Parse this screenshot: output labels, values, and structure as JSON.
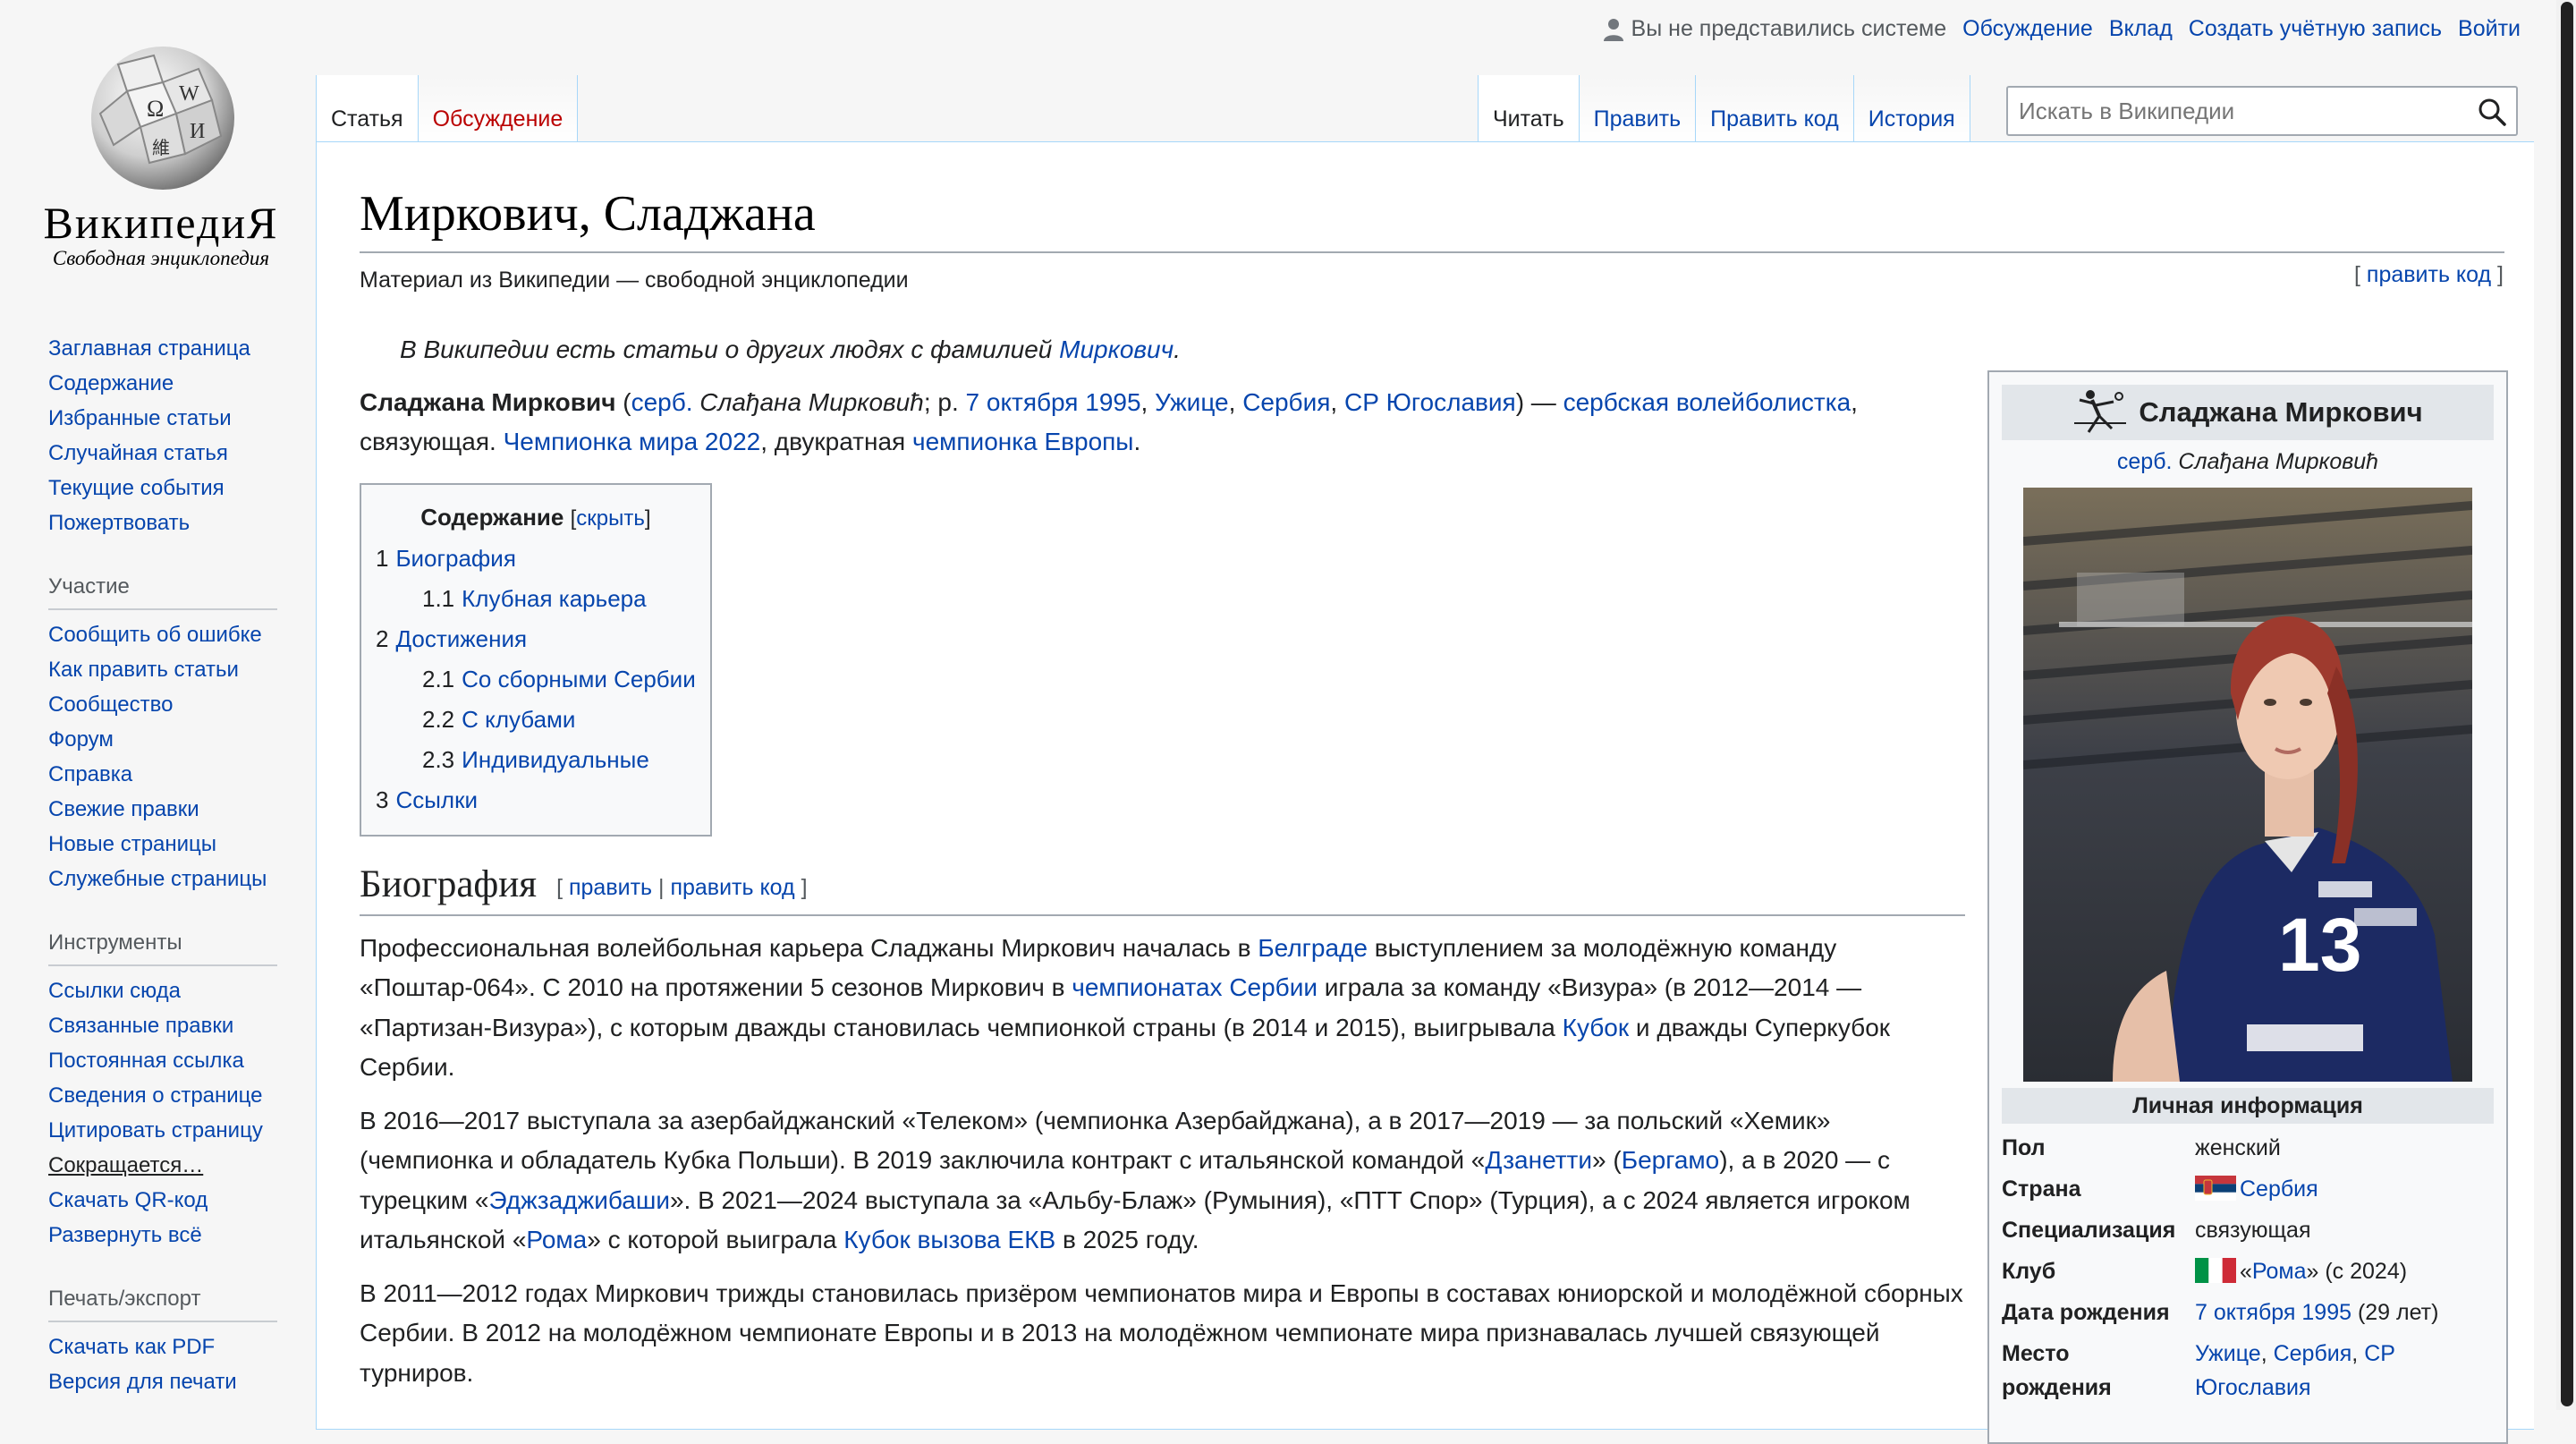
{
  "logo": {
    "wordmark": "ВикипедиЯ",
    "tagline": "Свободная энциклопедия"
  },
  "personal_tools": {
    "anon_text": "Вы не представились системе",
    "links": [
      "Обсуждение",
      "Вклад",
      "Создать учётную запись",
      "Войти"
    ]
  },
  "sidebar": {
    "navigation": [
      "Заглавная страница",
      "Содержание",
      "Избранные статьи",
      "Случайная статья",
      "Текущие события",
      "Пожертвовать"
    ],
    "participation": {
      "heading": "Участие",
      "items": [
        "Сообщить об ошибке",
        "Как править статьи",
        "Сообщество",
        "Форум",
        "Справка",
        "Свежие правки",
        "Новые страницы",
        "Служебные страницы"
      ]
    },
    "tools": {
      "heading": "Инструменты",
      "items": [
        "Ссылки сюда",
        "Связанные правки",
        "Постоянная ссылка",
        "Сведения о странице",
        "Цитировать страницу",
        "Сокращается…",
        "Скачать QR-код",
        "Развернуть всё"
      ]
    },
    "print": {
      "heading": "Печать/экспорт",
      "items": [
        "Скачать как PDF",
        "Версия для печати"
      ]
    }
  },
  "tabs": {
    "left": [
      "Статья",
      "Обсуждение"
    ],
    "right": [
      "Читать",
      "Править",
      "Править код",
      "История"
    ]
  },
  "search": {
    "placeholder": "Искать в Википедии"
  },
  "article": {
    "title": "Миркович, Сладжана",
    "site_sub": "Материал из Википедии — свободной энциклопедии",
    "top_edit": "править код",
    "hatnote_pre": "В Википедии есть статьи о других людях с фамилией ",
    "hatnote_link": "Миркович",
    "hatnote_post": ".",
    "lead": {
      "name": "Сладжана Миркович",
      "t1": " (",
      "serb_link": "серб.",
      "serb_name": " Слађана Мирковић",
      "t2": "; р. ",
      "date_link": "7 октября 1995",
      "t3": ", ",
      "city_link": "Ужице",
      "t4": ", ",
      "country_link": "Сербия",
      "t5": ", ",
      "sfry_link": "СР Югославия",
      "t6": ") — ",
      "player_link": "сербская волейболистка",
      "t7": ", связующая. ",
      "champ_link": "Чемпионка мира 2022",
      "t8": ", двукратная ",
      "europe_link": "чемпионка Европы",
      "t9": "."
    },
    "toc": {
      "title": "Содержание",
      "toggle": "скрыть",
      "items": [
        {
          "num": "1",
          "label": "Биография"
        },
        {
          "num": "1.1",
          "label": "Клубная карьера"
        },
        {
          "num": "2",
          "label": "Достижения"
        },
        {
          "num": "2.1",
          "label": "Со сборными Сербии"
        },
        {
          "num": "2.2",
          "label": "С клубами"
        },
        {
          "num": "2.3",
          "label": "Индивидуальные"
        },
        {
          "num": "3",
          "label": "Ссылки"
        }
      ]
    },
    "bio": {
      "heading": "Биография",
      "edit": "править",
      "edit_code": "править код",
      "p1": {
        "a": "Профессиональная волейбольная карьера Сладжаны Миркович началась в ",
        "l1": "Белграде",
        "b": " выступлением за молодёжную команду «Поштар-064». С 2010 на протяжении 5 сезонов Миркович в ",
        "l2": "чемпионатах Сербии",
        "c": " играла за команду «Визура» (в 2012—2014 — «Партизан-Визура»), с которым дважды становилась чемпионкой страны (в 2014 и 2015), выигрывала ",
        "l3": "Кубок",
        "d": " и дважды Суперкубок Сербии."
      },
      "p2": {
        "a": "В 2016—2017 выступала за азербайджанский «Телеком» (чемпионка Азербайджана), а в 2017—2019 — за польский «Хемик» (чемпионка и обладатель Кубка Польши). В 2019 заключила контракт с итальянской командой «",
        "l1": "Дзанетти",
        "b": "» (",
        "l2": "Бергамо",
        "c": "), а в 2020 — с турецким «",
        "l3": "Эджзаджибаши",
        "d": "». В 2021—2024 выступала за «Альбу-Блаж» (Румыния), «ПТТ Спор» (Турция), а с 2024 является игроком итальянской «",
        "l4": "Рома",
        "e": "» с которой выиграла ",
        "l5": "Кубок вызова ЕКВ",
        "f": " в 2025 году."
      },
      "p3": "В 2011—2012 годах Миркович трижды становилась призёром чемпионатов мира и Европы в составах юниорской и молодёжной сборных Сербии. В 2012 на молодёжном чемпионате Европы и в 2013 на молодёжном чемпионате мира признавалась лучшей связующей турниров."
    }
  },
  "infobox": {
    "title": "Сладжана Миркович",
    "sub_link": "серб.",
    "sub_text": " Слађана Мирковић",
    "section": "Личная информация",
    "jersey_number": "13",
    "rows": {
      "gender": {
        "k": "Пол",
        "v": "женский"
      },
      "country": {
        "k": "Страна",
        "v": "Сербия"
      },
      "spec": {
        "k": "Специализация",
        "v": "связующая"
      },
      "club": {
        "k": "Клуб",
        "pre": "«",
        "link": "Рома",
        "post": "» (с 2024)"
      },
      "birth": {
        "k": "Дата рождения",
        "link": "7 октября 1995",
        "post": " (29 лет)"
      },
      "place": {
        "k1": "Место",
        "k2": "рождения",
        "l1": "Ужице",
        "l2": "Сербия",
        "l3": "СР",
        "l4": "Югославия"
      }
    }
  },
  "colors": {
    "link": "#0645ad",
    "redlink": "#ba0000",
    "border": "#a7d7f9",
    "infobox_header": "#e2e6ea"
  }
}
